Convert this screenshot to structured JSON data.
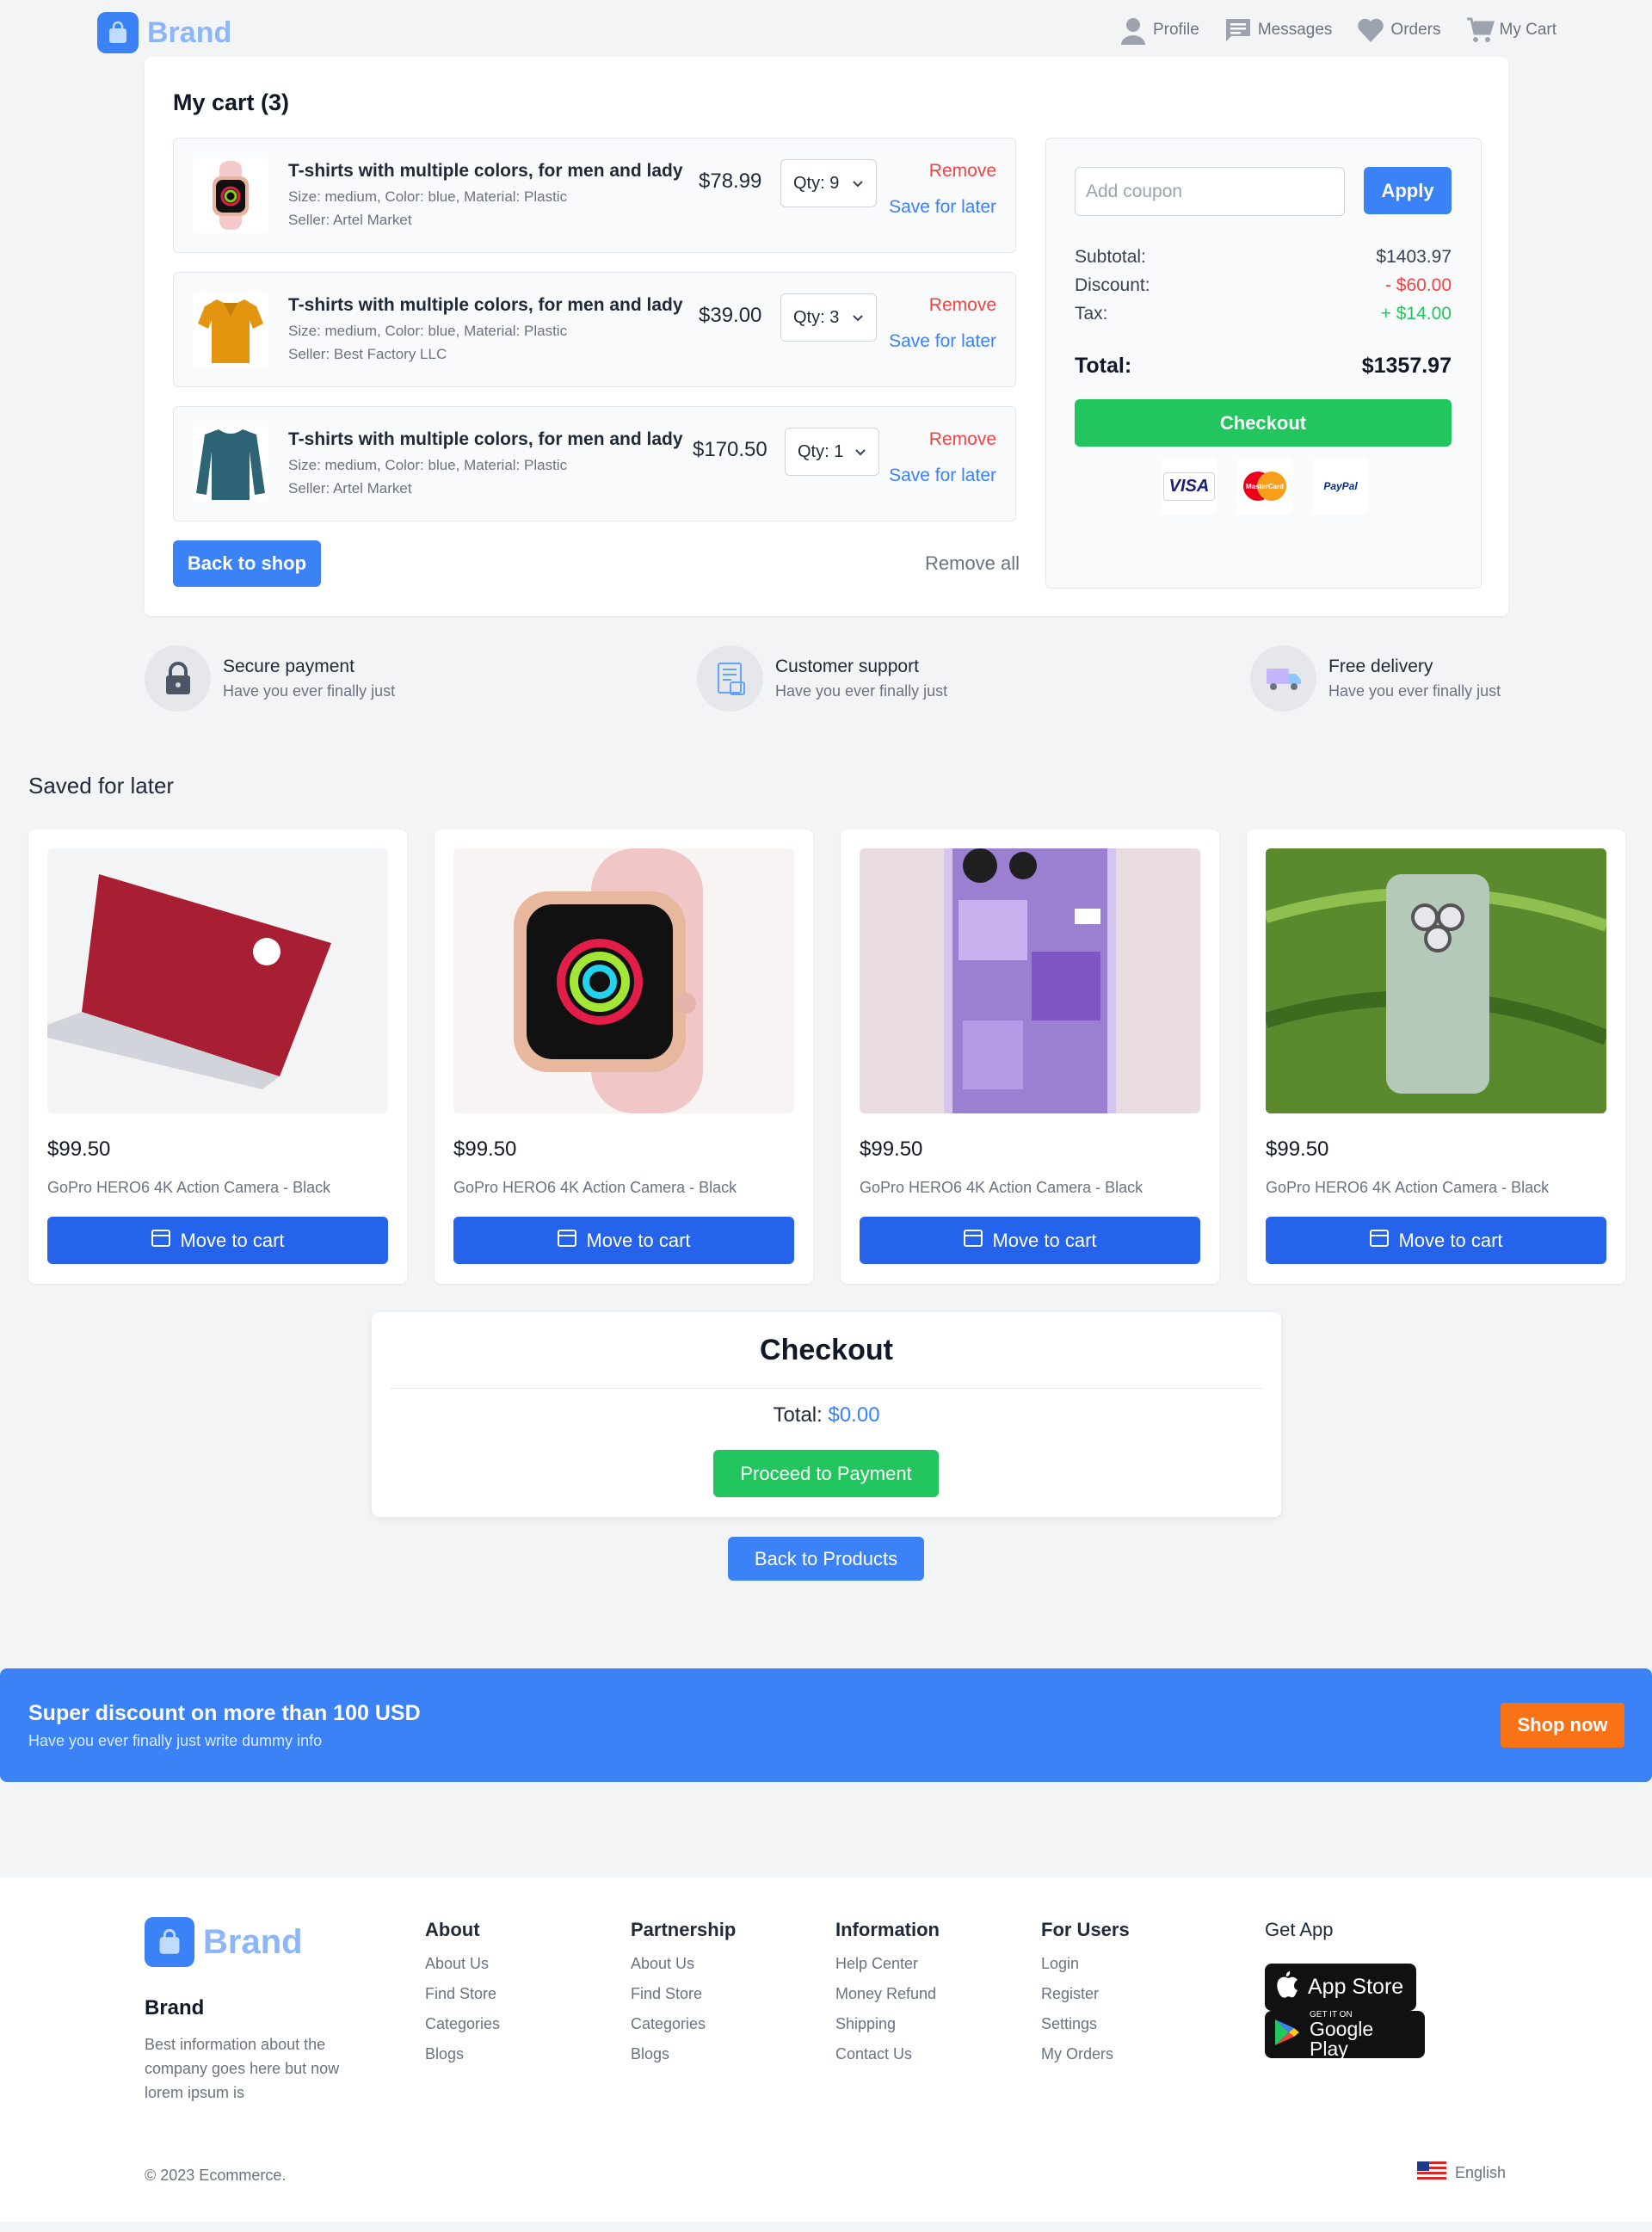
{
  "header": {
    "brand": "Brand",
    "nav": [
      {
        "label": "Profile",
        "icon": "user-icon"
      },
      {
        "label": "Messages",
        "icon": "message-icon"
      },
      {
        "label": "Orders",
        "icon": "heart-icon"
      },
      {
        "label": "My Cart",
        "icon": "cart-icon"
      }
    ]
  },
  "cart": {
    "title": "My cart (3)",
    "items": [
      {
        "name": "T-shirts with multiple colors, for men and lady",
        "meta": "Size: medium, Color: blue, Material: Plastic",
        "seller": "Seller: Artel Market",
        "price": "$78.99",
        "qty": "Qty: 9",
        "remove": "Remove",
        "save": "Save for later",
        "image": "watch"
      },
      {
        "name": "T-shirts with multiple colors, for men and lady",
        "meta": "Size: medium, Color: blue, Material: Plastic",
        "seller": "Seller: Best Factory LLC",
        "price": "$39.00",
        "qty": "Qty: 3",
        "remove": "Remove",
        "save": "Save for later",
        "image": "polo-shirt"
      },
      {
        "name": "T-shirts with multiple colors, for men and lady",
        "meta": "Size: medium, Color: blue, Material: Plastic",
        "seller": "Seller: Artel Market",
        "price": "$170.50",
        "qty": "Qty: 1",
        "remove": "Remove",
        "save": "Save for later",
        "image": "sweater"
      }
    ],
    "back_to_shop": "Back to shop",
    "remove_all": "Remove all"
  },
  "summary": {
    "coupon_placeholder": "Add coupon",
    "apply": "Apply",
    "subtotal_label": "Subtotal:",
    "subtotal": "$1403.97",
    "discount_label": "Discount:",
    "discount": "- $60.00",
    "tax_label": "Tax:",
    "tax": "+ $14.00",
    "total_label": "Total:",
    "total": "$1357.97",
    "checkout": "Checkout",
    "payment_methods": [
      "VISA",
      "MasterCard",
      "PayPal"
    ]
  },
  "features": [
    {
      "title": "Secure payment",
      "sub": "Have you ever finally just",
      "icon": "lock-icon"
    },
    {
      "title": "Customer support",
      "sub": "Have you ever finally just",
      "icon": "support-icon"
    },
    {
      "title": "Free delivery",
      "sub": "Have you ever finally just",
      "icon": "truck-icon"
    }
  ],
  "saved": {
    "title": "Saved for later",
    "items": [
      {
        "price": "$99.50",
        "name": "GoPro HERO6 4K Action Camera - Black",
        "button": "Move to cart",
        "image": "laptop"
      },
      {
        "price": "$99.50",
        "name": "GoPro HERO6 4K Action Camera - Black",
        "button": "Move to cart",
        "image": "smartwatch"
      },
      {
        "price": "$99.50",
        "name": "GoPro HERO6 4K Action Camera - Black",
        "button": "Move to cart",
        "image": "phone-case"
      },
      {
        "price": "$99.50",
        "name": "GoPro HERO6 4K Action Camera - Black",
        "button": "Move to cart",
        "image": "phone"
      }
    ]
  },
  "checkout_box": {
    "title": "Checkout",
    "total_label": "Total:",
    "total": "$0.00",
    "proceed": "Proceed to Payment",
    "back": "Back to Products"
  },
  "banner": {
    "title": "Super discount on more than 100 USD",
    "sub": "Have you ever finally just write dummy info",
    "button": "Shop now"
  },
  "footer": {
    "brand": "Brand",
    "brand_name": "Brand",
    "desc": "Best information about the company goes here but now lorem ipsum is",
    "columns": [
      {
        "title": "About",
        "links": [
          "About Us",
          "Find Store",
          "Categories",
          "Blogs"
        ]
      },
      {
        "title": "Partnership",
        "links": [
          "About Us",
          "Find Store",
          "Categories",
          "Blogs"
        ]
      },
      {
        "title": "Information",
        "links": [
          "Help Center",
          "Money Refund",
          "Shipping",
          "Contact Us"
        ]
      },
      {
        "title": "For Users",
        "links": [
          "Login",
          "Register",
          "Settings",
          "My Orders"
        ]
      }
    ],
    "get_app": "Get App",
    "app_store": "App Store",
    "google_play_small": "GET IT ON",
    "google_play": "Google Play",
    "copyright": "© 2023 Ecommerce.",
    "language": "English"
  },
  "colors": {
    "primary": "#3b82f6",
    "success": "#22c55e",
    "danger": "#ef4444",
    "accent": "#f97316"
  }
}
